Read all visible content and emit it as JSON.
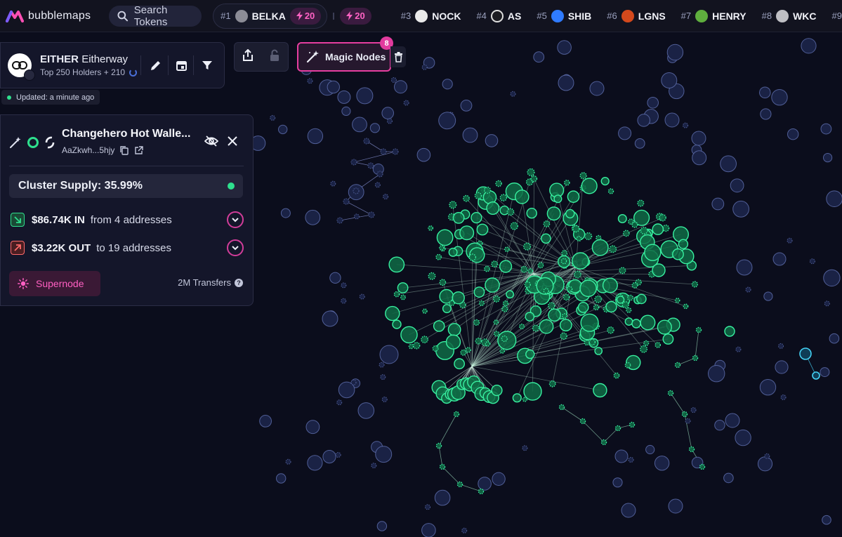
{
  "app": {
    "brand": "bubblemaps",
    "search_placeholder": "Search Tokens"
  },
  "ticker": {
    "first": {
      "rank": "#1",
      "name": "BELKA",
      "boost": "20"
    },
    "second_boost": "20",
    "items": [
      {
        "rank": "#3",
        "name": "NOCK",
        "icon": "nock-logo"
      },
      {
        "rank": "#4",
        "name": "AS",
        "icon": "as-logo"
      },
      {
        "rank": "#5",
        "name": "SHIB",
        "icon": "shib-logo"
      },
      {
        "rank": "#6",
        "name": "LGNS",
        "icon": "lgns-logo"
      },
      {
        "rank": "#7",
        "name": "HENRY",
        "icon": "henry-logo"
      },
      {
        "rank": "#8",
        "name": "WKC",
        "icon": "wkc-logo"
      },
      {
        "rank": "#9",
        "name": "",
        "icon": ""
      }
    ]
  },
  "token": {
    "symbol": "EITHER",
    "name": "Eitherway",
    "holders": "Top 250 Holders + 210",
    "updated": "Updated: a minute ago"
  },
  "toolbar": {
    "magic_label": "Magic Nodes",
    "magic_count": "8"
  },
  "wallet": {
    "name": "Changehero Hot Walle...",
    "address": "AaZkwh...5hjy",
    "cluster_supply": "Cluster Supply: 35.99%",
    "in_amount": "$86.74K IN",
    "in_detail": "from 4 addresses",
    "out_amount": "$3.22K OUT",
    "out_detail": "to 19 addresses",
    "supernode_label": "Supernode",
    "transfers": "2M Transfers"
  },
  "colors": {
    "accent_pink": "#e63ea0",
    "cluster_green": "#2ee08e",
    "bubble_blue": "#7d8cc9",
    "highlight_cyan": "#3fd0f0",
    "background": "#0b0d1c"
  }
}
